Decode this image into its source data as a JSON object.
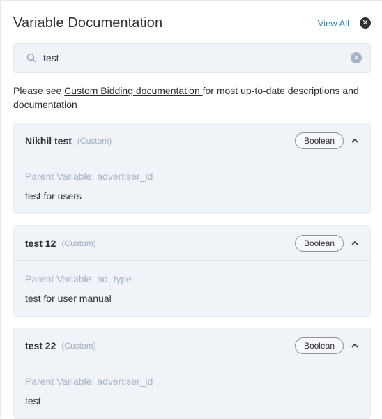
{
  "header": {
    "title": "Variable Documentation",
    "view_all_label": "View All",
    "close_icon": "close-icon"
  },
  "search": {
    "value": "test",
    "placeholder": "",
    "icon": "search-icon",
    "clear_icon": "clear-icon"
  },
  "info": {
    "prefix": "Please see ",
    "link_text": "Custom Bidding documentation ",
    "suffix": "for most up-to-date descriptions and documentation"
  },
  "variables": [
    {
      "name": "Nikhil test",
      "tag": "(Custom)",
      "type": "Boolean",
      "parent": "Parent Variable: advertiser_id",
      "description": "test for users"
    },
    {
      "name": "test 12",
      "tag": "(Custom)",
      "type": "Boolean",
      "parent": "Parent Variable: ad_type",
      "description": "test for user manual"
    },
    {
      "name": "test 22",
      "tag": "(Custom)",
      "type": "Boolean",
      "parent": "Parent Variable: advertiser_id",
      "description": "test"
    }
  ],
  "colors": {
    "accent_link": "#2b86b8",
    "card_bg": "#f0f3f8",
    "muted_text": "#a8b3c4"
  }
}
